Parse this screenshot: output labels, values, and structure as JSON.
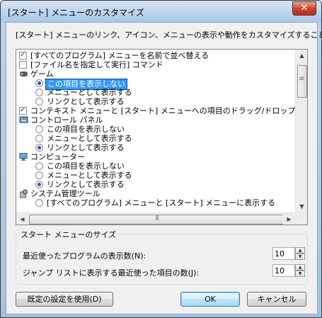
{
  "window": {
    "title": "[スタート] メニューのカスタマイズ",
    "close_glyph": "✕"
  },
  "description": "[スタート] メニューのリンク、アイコン、メニューの表示や動作をカスタマイズすることができます。",
  "options": [
    {
      "kind": "checkbox",
      "checked": true,
      "label": "[すべてのプログラム] メニューを名前で並べ替える"
    },
    {
      "kind": "checkbox",
      "checked": false,
      "label": "[ファイル名を指定して実行] コマンド"
    },
    {
      "kind": "header",
      "icon": "games-icon",
      "label": "ゲーム"
    },
    {
      "kind": "radio",
      "checked": true,
      "selected": true,
      "label": "この項目を表示しない"
    },
    {
      "kind": "radio",
      "checked": false,
      "label": "メニューとして表示する"
    },
    {
      "kind": "radio",
      "checked": false,
      "label": "リンクとして表示する"
    },
    {
      "kind": "checkbox",
      "checked": true,
      "label": "コンテキスト メニューと [スタート] メニューへの項目のドラッグ/ドロップを有効化する"
    },
    {
      "kind": "header",
      "icon": "control-panel-icon",
      "label": "コントロール パネル"
    },
    {
      "kind": "radio",
      "checked": false,
      "label": "この項目を表示しない"
    },
    {
      "kind": "radio",
      "checked": false,
      "label": "メニューとして表示する"
    },
    {
      "kind": "radio",
      "checked": true,
      "label": "リンクとして表示する"
    },
    {
      "kind": "header",
      "icon": "computer-icon",
      "label": "コンピューター"
    },
    {
      "kind": "radio",
      "checked": false,
      "label": "この項目を表示しない"
    },
    {
      "kind": "radio",
      "checked": false,
      "label": "メニューとして表示する"
    },
    {
      "kind": "radio",
      "checked": true,
      "label": "リンクとして表示する"
    },
    {
      "kind": "header",
      "icon": "admin-tools-icon",
      "label": "システム管理ツール"
    },
    {
      "kind": "radio",
      "checked": false,
      "label": "[すべてのプログラム] メニューと [スタート] メニューに表示する"
    }
  ],
  "size_group": {
    "title": "スタート メニューのサイズ",
    "recent_programs_label": "最近使ったプログラムの表示数(N):",
    "recent_programs_value": "10",
    "jump_list_label": "ジャンプ リストに表示する最近使った項目の数(J):",
    "jump_list_value": "10"
  },
  "buttons": {
    "defaults": "既定の設定を使用(D)",
    "ok": "OK",
    "cancel": "キャンセル"
  },
  "colors": {
    "selection": "#3399ff",
    "radio_dot": "#2b55a6"
  }
}
